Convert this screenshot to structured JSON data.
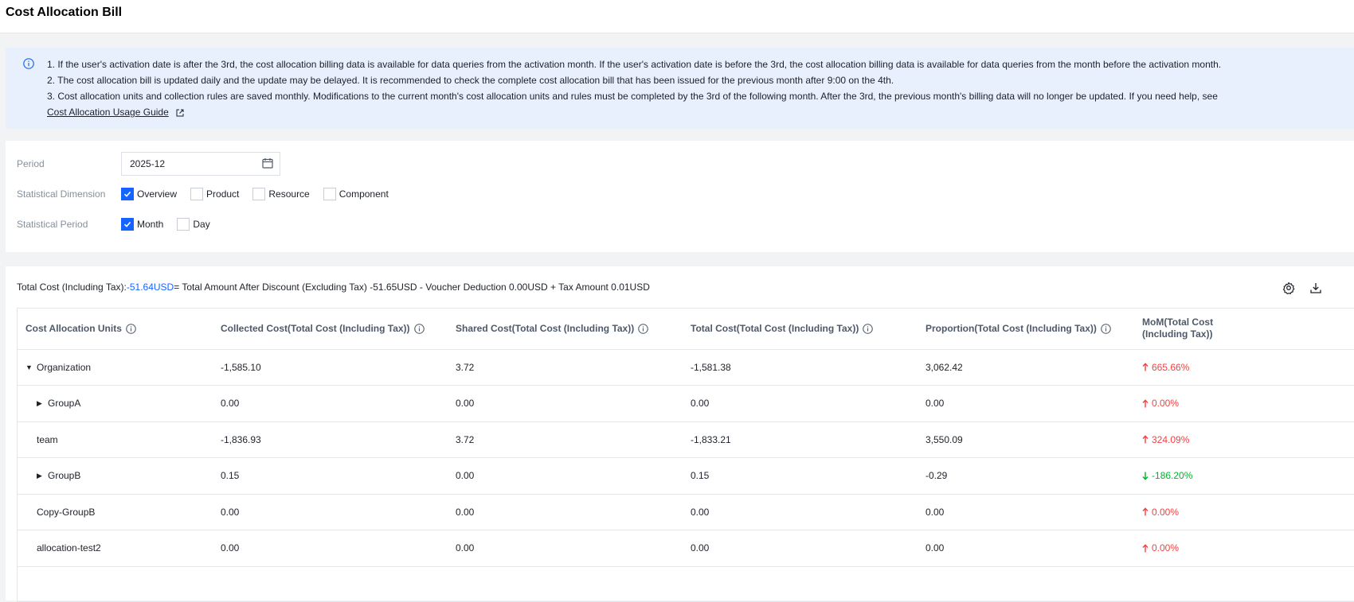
{
  "header": {
    "title": "Cost Allocation Bill"
  },
  "notice": {
    "lines": [
      "1. If the user's activation date is after the 3rd, the cost allocation billing data is available for data queries from the activation month. If the user's activation date is before the 3rd, the cost allocation billing data is available for data queries from the month before the activation month.",
      "2. The cost allocation bill is updated daily and the update may be delayed. It is recommended to check the complete cost allocation bill that has been issued for the previous month after 9:00 on the 4th.",
      "3. Cost allocation units and collection rules are saved monthly. Modifications to the current month's cost allocation units and rules must be completed by the 3rd of the following month. After the 3rd, the previous month's billing data will no longer be updated. If you need help, see"
    ],
    "link": "Cost Allocation Usage Guide"
  },
  "filters": {
    "period_label": "Period",
    "period_value": "2025-12",
    "dimension_label": "Statistical Dimension",
    "dimension_options": [
      {
        "label": "Overview",
        "checked": true
      },
      {
        "label": "Product",
        "checked": false
      },
      {
        "label": "Resource",
        "checked": false
      },
      {
        "label": "Component",
        "checked": false
      }
    ],
    "stat_period_label": "Statistical Period",
    "stat_period_options": [
      {
        "label": "Month",
        "checked": true
      },
      {
        "label": "Day",
        "checked": false
      }
    ]
  },
  "summary": {
    "prefix": "Total Cost (Including Tax):",
    "total": "-51.64USD",
    "rest": " = Total Amount After Discount (Excluding Tax) -51.65USD - Voucher Deduction 0.00USD + Tax Amount 0.01USD"
  },
  "table": {
    "columns": [
      "Cost Allocation Units",
      "Collected Cost(Total Cost (Including Tax))",
      "Shared Cost(Total Cost (Including Tax))",
      "Total Cost(Total Cost (Including Tax))",
      "Proportion(Total Cost (Including Tax))",
      "MoM(Total Cost (Including Tax))"
    ],
    "rows": [
      {
        "unit": "Organization",
        "expand": "open",
        "level": 0,
        "collected": "-1,585.10",
        "shared": "3.72",
        "total": "-1,581.38",
        "proportion": "3,062.42",
        "mom": "665.66%",
        "trend": "up"
      },
      {
        "unit": "GroupA",
        "expand": "closed",
        "level": 1,
        "collected": "0.00",
        "shared": "0.00",
        "total": "0.00",
        "proportion": "0.00",
        "mom": "0.00%",
        "trend": "up"
      },
      {
        "unit": "team",
        "expand": "none",
        "level": 1,
        "collected": "-1,836.93",
        "shared": "3.72",
        "total": "-1,833.21",
        "proportion": "3,550.09",
        "mom": "324.09%",
        "trend": "up"
      },
      {
        "unit": "GroupB",
        "expand": "closed",
        "level": 1,
        "collected": "0.15",
        "shared": "0.00",
        "total": "0.15",
        "proportion": "-0.29",
        "mom": "-186.20%",
        "trend": "down"
      },
      {
        "unit": "Copy-GroupB",
        "expand": "none",
        "level": 1,
        "collected": "0.00",
        "shared": "0.00",
        "total": "0.00",
        "proportion": "0.00",
        "mom": "0.00%",
        "trend": "up"
      },
      {
        "unit": "allocation-test2",
        "expand": "none",
        "level": 1,
        "collected": "0.00",
        "shared": "0.00",
        "total": "0.00",
        "proportion": "0.00",
        "mom": "0.00%",
        "trend": "up"
      }
    ]
  },
  "colors": {
    "accent": "#1664ff",
    "up": "#f53f3f",
    "down": "#00b42a",
    "notice_bg": "#e8effd"
  },
  "icons": {
    "info": "info-circle-icon",
    "external": "external-link-icon",
    "calendar": "calendar-icon",
    "settings": "gear-icon",
    "download": "download-icon"
  }
}
